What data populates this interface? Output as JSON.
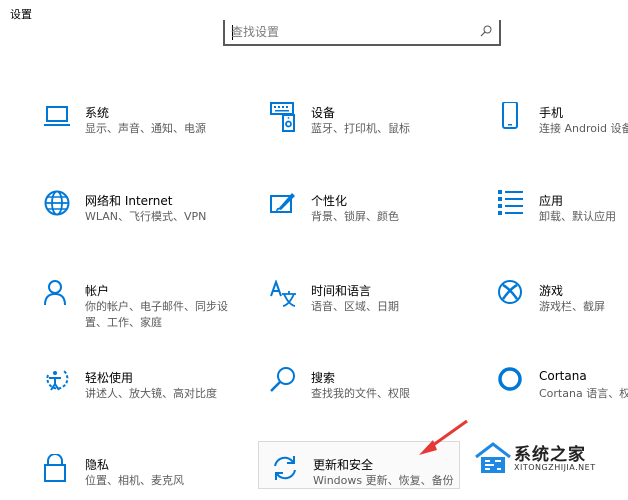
{
  "window": {
    "title": "设置"
  },
  "search": {
    "placeholder": "查找设置"
  },
  "tiles": [
    {
      "title": "系统",
      "desc": "显示、声音、通知、电源",
      "icon": "laptop-icon"
    },
    {
      "title": "设备",
      "desc": "蓝牙、打印机、鼠标",
      "icon": "devices-icon"
    },
    {
      "title": "手机",
      "desc": "连接 Android 设备",
      "icon": "phone-icon"
    },
    {
      "title": "网络和 Internet",
      "desc": "WLAN、飞行模式、VPN",
      "icon": "globe-icon"
    },
    {
      "title": "个性化",
      "desc": "背景、锁屏、颜色",
      "icon": "paint-icon"
    },
    {
      "title": "应用",
      "desc": "卸载、默认应用",
      "icon": "apps-list-icon"
    },
    {
      "title": "帐户",
      "desc": "你的帐户、电子邮件、同步设置、工作、家庭",
      "icon": "person-icon"
    },
    {
      "title": "时间和语言",
      "desc": "语音、区域、日期",
      "icon": "time-language-icon"
    },
    {
      "title": "游戏",
      "desc": "游戏栏、截屏",
      "icon": "xbox-icon"
    },
    {
      "title": "轻松使用",
      "desc": "讲述人、放大镜、高对比度",
      "icon": "ease-of-access-icon"
    },
    {
      "title": "搜索",
      "desc": "查找我的文件、权限",
      "icon": "search-magnifier-icon"
    },
    {
      "title": "Cortana",
      "desc": "Cortana 语言、权限",
      "icon": "cortana-circle-icon"
    },
    {
      "title": "隐私",
      "desc": "位置、相机、麦克风",
      "icon": "lock-icon"
    },
    {
      "title": "更新和安全",
      "desc": "Windows 更新、恢复、备份",
      "icon": "update-sync-icon"
    }
  ],
  "watermark": {
    "main": "系统之家",
    "sub": "XITONGZHIJIA.NET"
  },
  "colors": {
    "accent": "#0078d7",
    "arrow": "#e53935"
  }
}
